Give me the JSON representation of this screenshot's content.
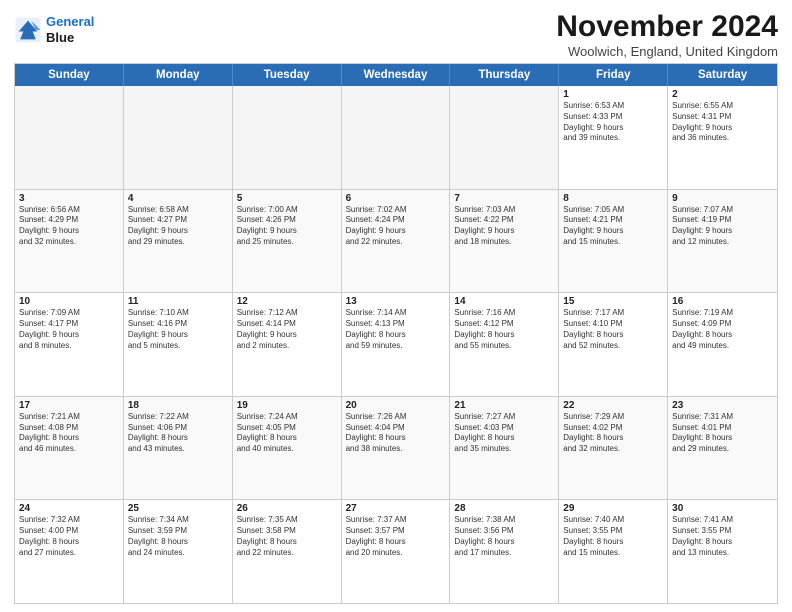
{
  "logo": {
    "line1": "General",
    "line2": "Blue"
  },
  "title": "November 2024",
  "location": "Woolwich, England, United Kingdom",
  "header_days": [
    "Sunday",
    "Monday",
    "Tuesday",
    "Wednesday",
    "Thursday",
    "Friday",
    "Saturday"
  ],
  "weeks": [
    [
      {
        "day": "",
        "text": ""
      },
      {
        "day": "",
        "text": ""
      },
      {
        "day": "",
        "text": ""
      },
      {
        "day": "",
        "text": ""
      },
      {
        "day": "",
        "text": ""
      },
      {
        "day": "1",
        "text": "Sunrise: 6:53 AM\nSunset: 4:33 PM\nDaylight: 9 hours\nand 39 minutes."
      },
      {
        "day": "2",
        "text": "Sunrise: 6:55 AM\nSunset: 4:31 PM\nDaylight: 9 hours\nand 36 minutes."
      }
    ],
    [
      {
        "day": "3",
        "text": "Sunrise: 6:56 AM\nSunset: 4:29 PM\nDaylight: 9 hours\nand 32 minutes."
      },
      {
        "day": "4",
        "text": "Sunrise: 6:58 AM\nSunset: 4:27 PM\nDaylight: 9 hours\nand 29 minutes."
      },
      {
        "day": "5",
        "text": "Sunrise: 7:00 AM\nSunset: 4:26 PM\nDaylight: 9 hours\nand 25 minutes."
      },
      {
        "day": "6",
        "text": "Sunrise: 7:02 AM\nSunset: 4:24 PM\nDaylight: 9 hours\nand 22 minutes."
      },
      {
        "day": "7",
        "text": "Sunrise: 7:03 AM\nSunset: 4:22 PM\nDaylight: 9 hours\nand 18 minutes."
      },
      {
        "day": "8",
        "text": "Sunrise: 7:05 AM\nSunset: 4:21 PM\nDaylight: 9 hours\nand 15 minutes."
      },
      {
        "day": "9",
        "text": "Sunrise: 7:07 AM\nSunset: 4:19 PM\nDaylight: 9 hours\nand 12 minutes."
      }
    ],
    [
      {
        "day": "10",
        "text": "Sunrise: 7:09 AM\nSunset: 4:17 PM\nDaylight: 9 hours\nand 8 minutes."
      },
      {
        "day": "11",
        "text": "Sunrise: 7:10 AM\nSunset: 4:16 PM\nDaylight: 9 hours\nand 5 minutes."
      },
      {
        "day": "12",
        "text": "Sunrise: 7:12 AM\nSunset: 4:14 PM\nDaylight: 9 hours\nand 2 minutes."
      },
      {
        "day": "13",
        "text": "Sunrise: 7:14 AM\nSunset: 4:13 PM\nDaylight: 8 hours\nand 59 minutes."
      },
      {
        "day": "14",
        "text": "Sunrise: 7:16 AM\nSunset: 4:12 PM\nDaylight: 8 hours\nand 55 minutes."
      },
      {
        "day": "15",
        "text": "Sunrise: 7:17 AM\nSunset: 4:10 PM\nDaylight: 8 hours\nand 52 minutes."
      },
      {
        "day": "16",
        "text": "Sunrise: 7:19 AM\nSunset: 4:09 PM\nDaylight: 8 hours\nand 49 minutes."
      }
    ],
    [
      {
        "day": "17",
        "text": "Sunrise: 7:21 AM\nSunset: 4:08 PM\nDaylight: 8 hours\nand 46 minutes."
      },
      {
        "day": "18",
        "text": "Sunrise: 7:22 AM\nSunset: 4:06 PM\nDaylight: 8 hours\nand 43 minutes."
      },
      {
        "day": "19",
        "text": "Sunrise: 7:24 AM\nSunset: 4:05 PM\nDaylight: 8 hours\nand 40 minutes."
      },
      {
        "day": "20",
        "text": "Sunrise: 7:26 AM\nSunset: 4:04 PM\nDaylight: 8 hours\nand 38 minutes."
      },
      {
        "day": "21",
        "text": "Sunrise: 7:27 AM\nSunset: 4:03 PM\nDaylight: 8 hours\nand 35 minutes."
      },
      {
        "day": "22",
        "text": "Sunrise: 7:29 AM\nSunset: 4:02 PM\nDaylight: 8 hours\nand 32 minutes."
      },
      {
        "day": "23",
        "text": "Sunrise: 7:31 AM\nSunset: 4:01 PM\nDaylight: 8 hours\nand 29 minutes."
      }
    ],
    [
      {
        "day": "24",
        "text": "Sunrise: 7:32 AM\nSunset: 4:00 PM\nDaylight: 8 hours\nand 27 minutes."
      },
      {
        "day": "25",
        "text": "Sunrise: 7:34 AM\nSunset: 3:59 PM\nDaylight: 8 hours\nand 24 minutes."
      },
      {
        "day": "26",
        "text": "Sunrise: 7:35 AM\nSunset: 3:58 PM\nDaylight: 8 hours\nand 22 minutes."
      },
      {
        "day": "27",
        "text": "Sunrise: 7:37 AM\nSunset: 3:57 PM\nDaylight: 8 hours\nand 20 minutes."
      },
      {
        "day": "28",
        "text": "Sunrise: 7:38 AM\nSunset: 3:56 PM\nDaylight: 8 hours\nand 17 minutes."
      },
      {
        "day": "29",
        "text": "Sunrise: 7:40 AM\nSunset: 3:55 PM\nDaylight: 8 hours\nand 15 minutes."
      },
      {
        "day": "30",
        "text": "Sunrise: 7:41 AM\nSunset: 3:55 PM\nDaylight: 8 hours\nand 13 minutes."
      }
    ]
  ]
}
